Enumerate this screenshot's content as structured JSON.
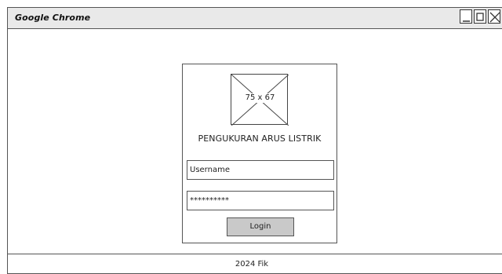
{
  "window": {
    "title": "Google Chrome"
  },
  "login": {
    "logo_placeholder_text": "75 x 67",
    "app_title": "PENGUKURAN ARUS LISTRIK",
    "username_value": "Username",
    "password_value": "**********",
    "login_label": "Login"
  },
  "footer": {
    "text": "2024 Fik"
  },
  "icons": {
    "minimize": "minimize-icon",
    "maximize": "maximize-icon",
    "close": "close-icon",
    "image_placeholder": "image-placeholder-icon"
  }
}
